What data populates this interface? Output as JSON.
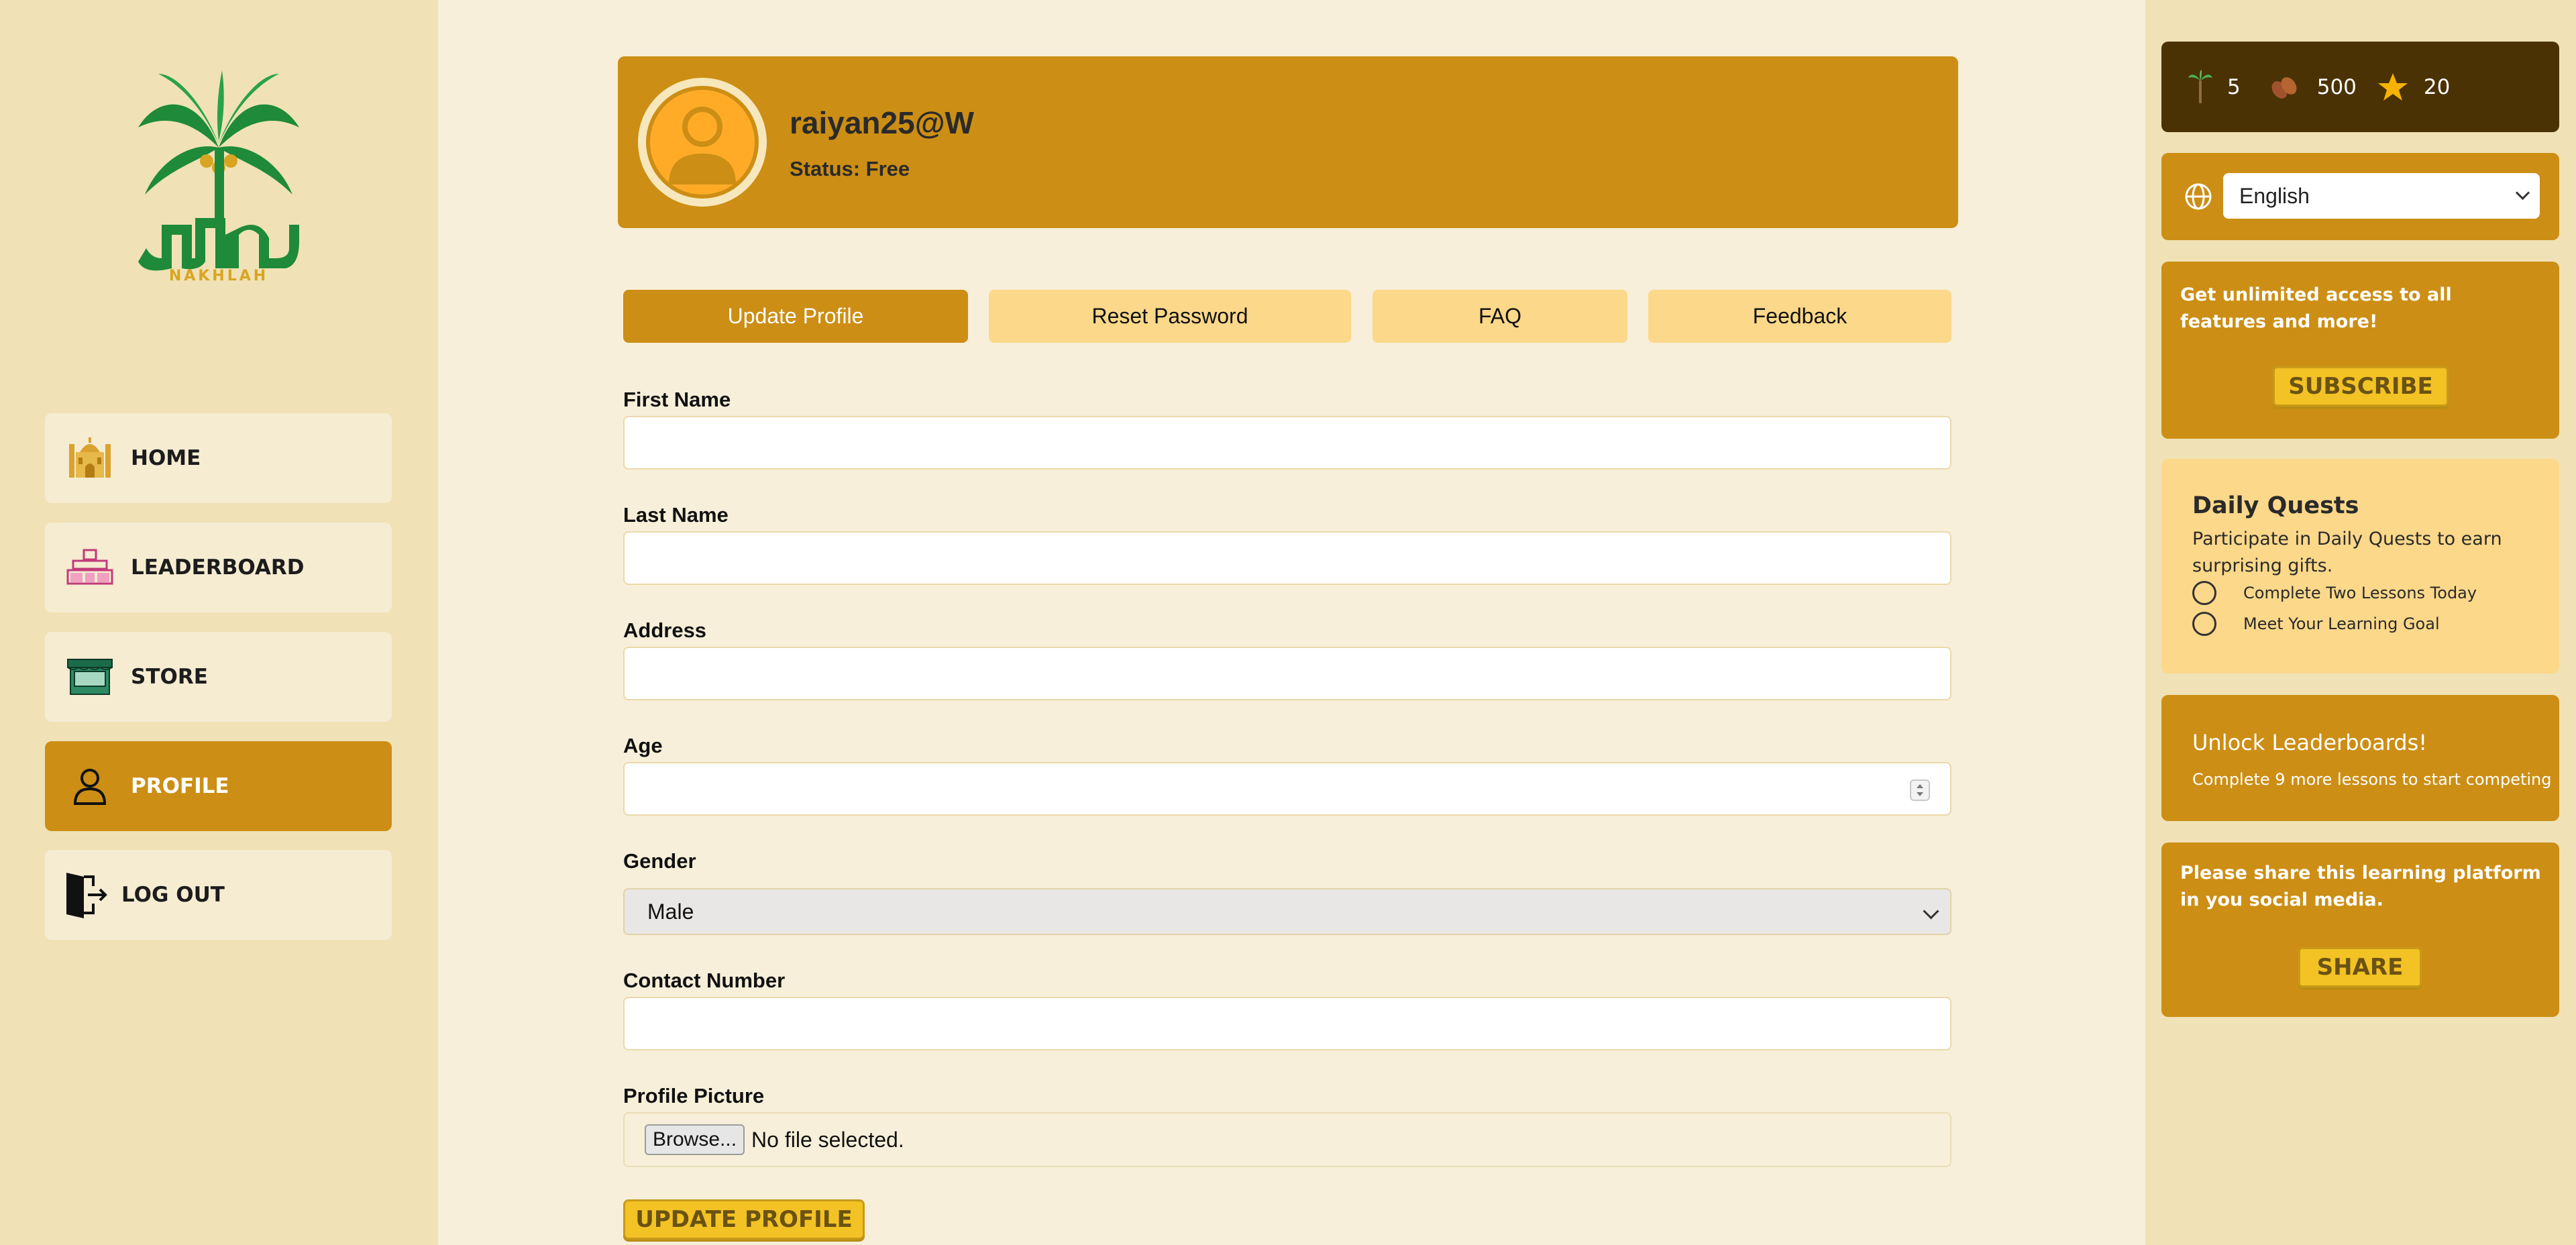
{
  "brand": {
    "logo_text": "NAKHLAH",
    "colors": {
      "gold": "#cc8e14",
      "cream": "#f7efd9",
      "sidebar": "#f0e2b6",
      "dark": "#4a3205",
      "yellow": "#f3c224"
    }
  },
  "nav": {
    "items": [
      {
        "label": "HOME",
        "icon": "mosque-icon",
        "active": false
      },
      {
        "label": "LEADERBOARD",
        "icon": "leaderboard-icon",
        "active": false
      },
      {
        "label": "STORE",
        "icon": "store-icon",
        "active": false
      },
      {
        "label": "PROFILE",
        "icon": "person-icon",
        "active": true
      },
      {
        "label": "LOG OUT",
        "icon": "logout-icon",
        "active": false
      }
    ]
  },
  "profile": {
    "username": "raiyan25@W",
    "status": "Status: Free"
  },
  "tabs": [
    {
      "label": "Update Profile",
      "active": true
    },
    {
      "label": "Reset Password",
      "active": false
    },
    {
      "label": "FAQ",
      "active": false
    },
    {
      "label": "Feedback",
      "active": false
    }
  ],
  "form": {
    "first_name": {
      "label": "First Name",
      "value": ""
    },
    "last_name": {
      "label": "Last Name",
      "value": ""
    },
    "address": {
      "label": "Address",
      "value": ""
    },
    "age": {
      "label": "Age",
      "value": ""
    },
    "gender": {
      "label": "Gender",
      "value": "Male"
    },
    "contact": {
      "label": "Contact Number",
      "value": ""
    },
    "picture": {
      "label": "Profile Picture",
      "browse_label": "Browse...",
      "file_status": "No file selected."
    },
    "submit_label": "UPDATE PROFILE"
  },
  "stats": {
    "palms": "5",
    "dates": "500",
    "stars": "20"
  },
  "language": {
    "selected": "English"
  },
  "subscribe": {
    "text": "Get unlimited access to all features and more!",
    "button": "SUBSCRIBE"
  },
  "quests": {
    "title": "Daily Quests",
    "description": "Participate in Daily Quests to earn surprising gifts.",
    "items": [
      "Complete Two Lessons Today",
      "Meet Your Learning Goal"
    ]
  },
  "leaderboard_unlock": {
    "title": "Unlock Leaderboards!",
    "text": "Complete 9 more lessons to start competing"
  },
  "share": {
    "text": "Please share this learning platform in you social media.",
    "button": "SHARE"
  }
}
